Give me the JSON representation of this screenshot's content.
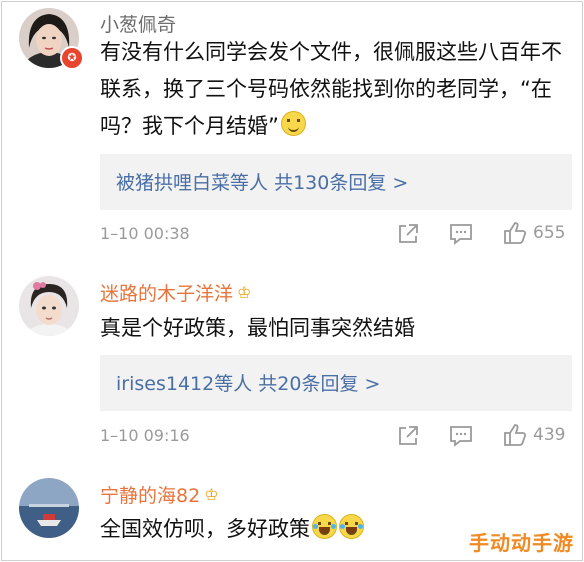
{
  "colors": {
    "username_gray": "#6e6e6e",
    "username_orange": "#e8743b",
    "link_blue": "#4a6fa5",
    "meta_gray": "#9a9a9a",
    "reply_bg": "#f2f2f2",
    "watermark": "#f08a24"
  },
  "comments": [
    {
      "username": "小葱佩奇",
      "text": "有没有什么同学会发个文件，很佩服这些八百年不联系，换了三个号码依然能找到你的老同学，“在吗？我下个月结婚”",
      "emoji": "smile-emoji",
      "reply_users": "被猪拱哩白菜",
      "reply_mid": "等人 ",
      "reply_count": "共130条回复 >",
      "time": "1–10 00:38",
      "likes": "655"
    },
    {
      "username": "迷路的木子洋洋",
      "text": "真是个好政策，最怕同事突然结婚",
      "reply_users": "irises1412",
      "reply_mid": "等人 ",
      "reply_count": "共20条回复 >",
      "time": "1–10 09:16",
      "likes": "439"
    },
    {
      "username": "宁静的海82",
      "text": "全国效仿呗，多好政策",
      "emoji": "laugh-cry-emoji"
    }
  ],
  "icons": {
    "share": "share-icon",
    "comment": "comment-icon",
    "like": "thumbs-up-icon",
    "crown": "crown-icon"
  },
  "watermark": "手动动手游"
}
